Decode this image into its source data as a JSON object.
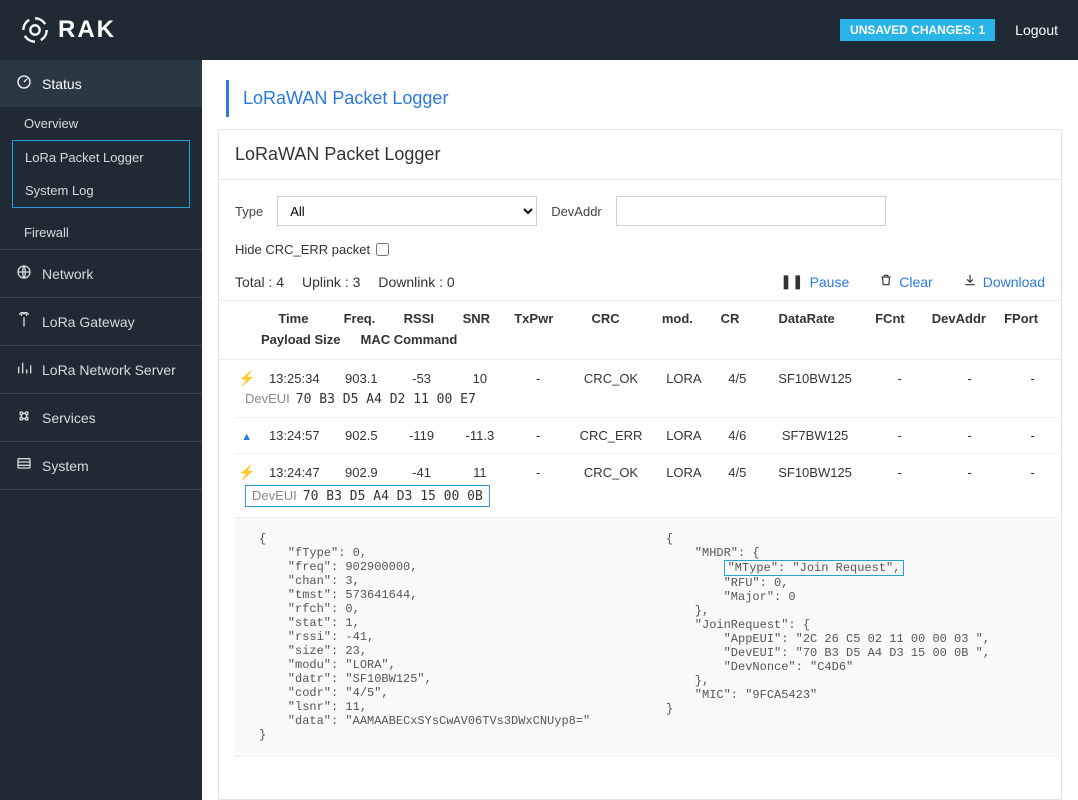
{
  "header": {
    "brand": "RAK",
    "unsaved_label": "UNSAVED CHANGES: 1",
    "logout": "Logout"
  },
  "sidebar": {
    "status": {
      "label": "Status",
      "overview": "Overview",
      "packet_logger": "LoRa Packet Logger",
      "system_log": "System Log",
      "firewall": "Firewall"
    },
    "network": "Network",
    "lora_gateway": "LoRa Gateway",
    "lora_network_server": "LoRa Network Server",
    "services": "Services",
    "system": "System"
  },
  "breadcrumb": "LoRaWAN Packet Logger",
  "panel_title": "LoRaWAN Packet Logger",
  "filters": {
    "type_label": "Type",
    "type_value": "All",
    "devaddr_label": "DevAddr",
    "devaddr_value": "",
    "hide_crc_label": "Hide CRC_ERR packet"
  },
  "summary": {
    "total": "Total : 4",
    "uplink": "Uplink : 3",
    "downlink": "Downlink : 0",
    "pause": "Pause",
    "clear": "Clear",
    "download": "Download"
  },
  "columns": {
    "time": "Time",
    "freq": "Freq.",
    "rssi": "RSSI",
    "snr": "SNR",
    "txpwr": "TxPwr",
    "crc": "CRC",
    "mod": "mod.",
    "cr": "CR",
    "datarate": "DataRate",
    "fcnt": "FCnt",
    "devaddr": "DevAddr",
    "fport": "FPort",
    "payload_size": "Payload Size",
    "mac_command": "MAC Command"
  },
  "packets": [
    {
      "icon": "bolt",
      "time": "13:25:34",
      "freq": "903.1",
      "rssi": "-53",
      "snr": "10",
      "txpwr": "-",
      "crc": "CRC_OK",
      "mod": "LORA",
      "cr": "4/5",
      "dr": "SF10BW125",
      "fcnt": "-",
      "devaddr": "-",
      "fport": "-",
      "deveui_label": "DevEUI",
      "deveui": "70 B3 D5 A4 D2 11 00 E7"
    },
    {
      "icon": "tri",
      "time": "13:24:57",
      "freq": "902.5",
      "rssi": "-119",
      "snr": "-11.3",
      "txpwr": "-",
      "crc": "CRC_ERR",
      "mod": "LORA",
      "cr": "4/6",
      "dr": "SF7BW125",
      "fcnt": "-",
      "devaddr": "-",
      "fport": "-"
    },
    {
      "icon": "bolt",
      "time": "13:24:47",
      "freq": "902.9",
      "rssi": "-41",
      "snr": "11",
      "txpwr": "-",
      "crc": "CRC_OK",
      "mod": "LORA",
      "cr": "4/5",
      "dr": "SF10BW125",
      "fcnt": "-",
      "devaddr": "-",
      "fport": "-",
      "deveui_label": "DevEUI",
      "deveui": "70 B3 D5 A4 D3 15 00 0B",
      "boxed": true
    }
  ],
  "detail": {
    "left": "{\n    \"fType\": 0,\n    \"freq\": 902900000,\n    \"chan\": 3,\n    \"tmst\": 573641644,\n    \"rfch\": 0,\n    \"stat\": 1,\n    \"rssi\": -41,\n    \"size\": 23,\n    \"modu\": \"LORA\",\n    \"datr\": \"SF10BW125\",\n    \"codr\": \"4/5\",\n    \"lsnr\": 11,\n    \"data\": \"AAMAABECxSYsCwAV06TVs3DWxCNUyp8=\"\n}",
    "right_prefix": "{\n    \"MHDR\": {\n        ",
    "right_hl": "\"MType\": \"Join Request\",",
    "right_suffix": "\n        \"RFU\": 0,\n        \"Major\": 0\n    },\n    \"JoinRequest\": {\n        \"AppEUI\": \"2C 26 C5 02 11 00 00 03 \",\n        \"DevEUI\": \"70 B3 D5 A4 D3 15 00 0B \",\n        \"DevNonce\": \"C4D6\"\n    },\n    \"MIC\": \"9FCA5423\"\n}"
  }
}
